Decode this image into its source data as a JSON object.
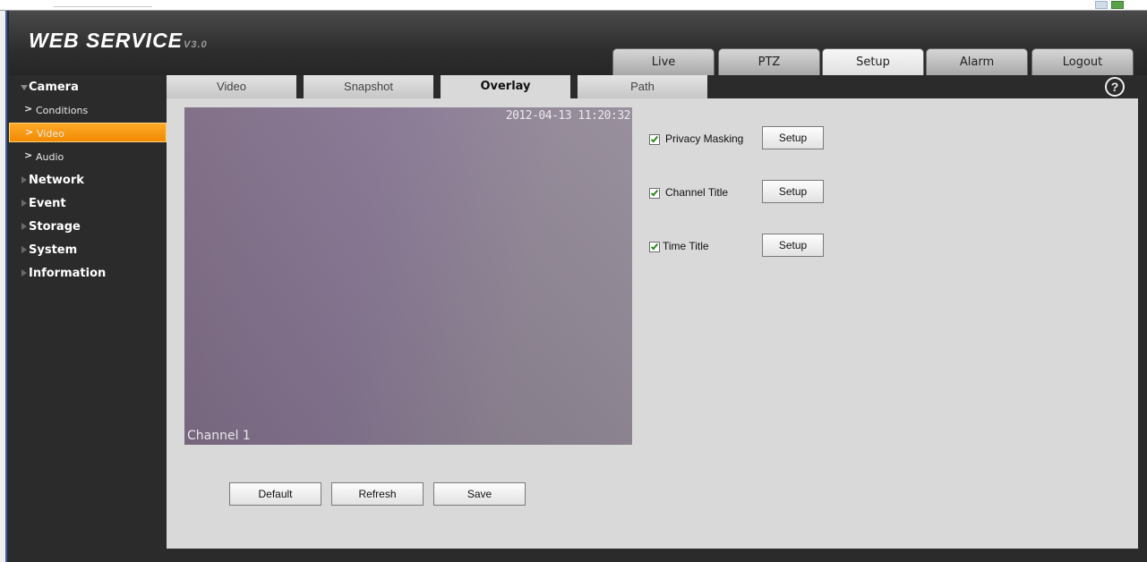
{
  "app": {
    "title": "WEB SERVICE",
    "version": "V3.0"
  },
  "main_tabs": [
    {
      "label": "Live"
    },
    {
      "label": "PTZ"
    },
    {
      "label": "Setup"
    },
    {
      "label": "Alarm"
    },
    {
      "label": "Logout"
    }
  ],
  "sidebar": {
    "camera": "Camera",
    "conditions": "Conditions",
    "video": "Video",
    "audio": "Audio",
    "network": "Network",
    "event": "Event",
    "storage": "Storage",
    "system": "System",
    "information": "Information"
  },
  "sub_tabs": [
    {
      "label": "Video"
    },
    {
      "label": "Snapshot"
    },
    {
      "label": "Overlay"
    },
    {
      "label": "Path"
    }
  ],
  "help": {
    "glyph": "?"
  },
  "preview": {
    "timestamp": "2012-04-13 11:20:32",
    "channel": "Channel 1"
  },
  "options": [
    {
      "label": "Privacy Masking",
      "checked": true,
      "button": "Setup"
    },
    {
      "label": "Channel Title",
      "checked": true,
      "button": "Setup"
    },
    {
      "label": "Time Title",
      "checked": true,
      "button": "Setup"
    }
  ],
  "actions": {
    "default": "Default",
    "refresh": "Refresh",
    "save": "Save"
  },
  "colors": {
    "accent": "#f5a000",
    "panel": "#d9d9d9",
    "chrome": "#2b2b2b"
  }
}
